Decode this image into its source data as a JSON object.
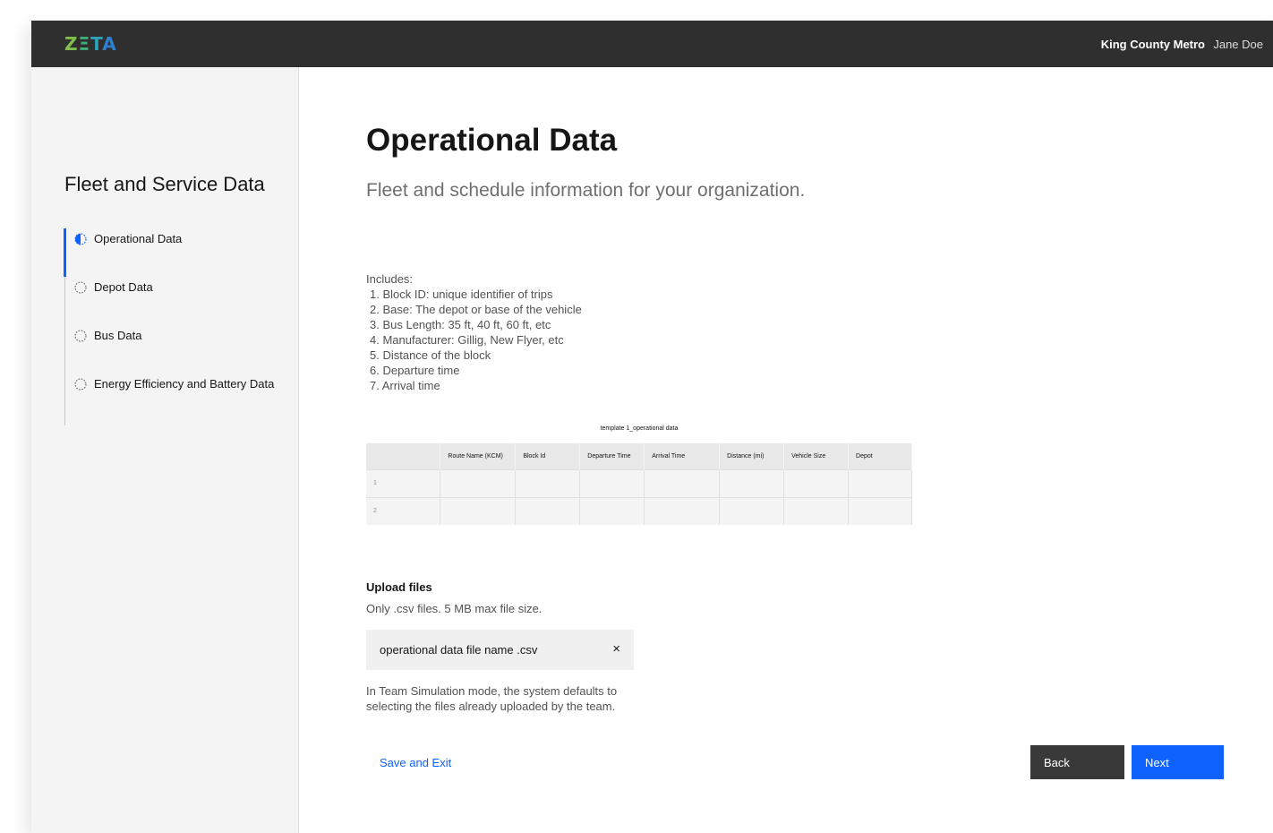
{
  "header": {
    "logo": [
      "Z",
      "Ξ",
      "T",
      "A"
    ],
    "organization": "King County Metro",
    "user": "Jane Doe"
  },
  "sidebar": {
    "title": "Fleet and Service Data",
    "steps": [
      {
        "label": "Operational Data",
        "state": "current"
      },
      {
        "label": "Depot Data",
        "state": "incomplete"
      },
      {
        "label": "Bus Data",
        "state": "incomplete"
      },
      {
        "label": "Energy Efficiency and Battery Data",
        "state": "incomplete"
      }
    ]
  },
  "main": {
    "title": "Operational Data",
    "subtitle": "Fleet and schedule information for your organization.",
    "includes_label": "Includes:",
    "includes": [
      "1. Block ID: unique identifier of trips",
      "2. Base: The depot or base of the vehicle",
      "3. Bus Length: 35 ft, 40 ft, 60 ft, etc",
      "4. Manufacturer: Gillig, New Flyer, etc",
      "5. Distance of the block",
      "6. Departure time",
      "7. Arrival time"
    ],
    "template": {
      "caption": "template 1_operational data",
      "columns": [
        "",
        "Route Name (KCM)",
        "Block Id",
        "Departure Time",
        "Arrival Time",
        "Distance (mi)",
        "Vehicle Size",
        "Depot"
      ],
      "rows": [
        [
          "1",
          "",
          "",
          "",
          "",
          "",
          "",
          ""
        ],
        [
          "2",
          "",
          "",
          "",
          "",
          "",
          "",
          ""
        ]
      ]
    },
    "upload": {
      "title": "Upload files",
      "subtitle": "Only .csv files. 5 MB max file size.",
      "file_name": "operational data file name .csv",
      "remove_icon": "×"
    },
    "note": "In Team Simulation mode, the system defaults to selecting the files already uploaded by the team.",
    "actions": {
      "save_exit": "Save and Exit",
      "back": "Back",
      "next": "Next"
    }
  },
  "colors": {
    "header_bg": "#2f2f2f",
    "sidebar_bg": "#f4f4f4",
    "primary": "#0f62fe",
    "secondary_button": "#393939"
  },
  "icons": {
    "current_step": "half-filled-circle-icon",
    "incomplete_step": "dashed-circle-icon",
    "remove_file": "close-icon"
  }
}
